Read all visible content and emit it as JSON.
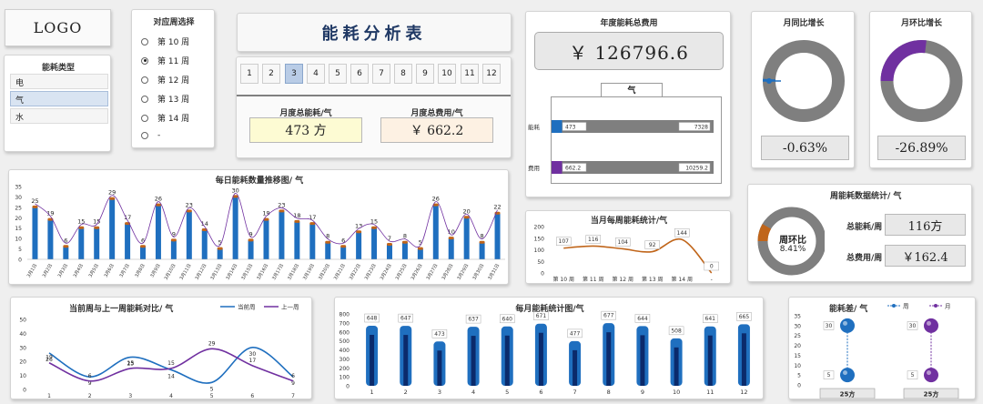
{
  "logo": "LOGO",
  "energy_type": {
    "title": "能耗类型",
    "items": [
      {
        "label": "电",
        "selected": false
      },
      {
        "label": "气",
        "selected": true
      },
      {
        "label": "水",
        "selected": false
      }
    ]
  },
  "week_select": {
    "title": "对应周选择",
    "weeks": [
      {
        "label": "第 10 周",
        "selected": false
      },
      {
        "label": "第 11 周",
        "selected": true
      },
      {
        "label": "第 12 周",
        "selected": false
      },
      {
        "label": "第 13 周",
        "selected": false
      },
      {
        "label": "第 14 周",
        "selected": false
      },
      {
        "label": "-",
        "selected": false
      }
    ]
  },
  "main_title": "能耗分析表",
  "months": {
    "labels": [
      "1",
      "2",
      "3",
      "4",
      "5",
      "6",
      "7",
      "8",
      "9",
      "10",
      "11",
      "12"
    ],
    "selected_index": 2
  },
  "monthly_kpi": {
    "energy_label": "月度总能耗/气",
    "energy_value": "473 方",
    "cost_label": "月度总费用/气",
    "cost_value": "￥ 662.2"
  },
  "annual": {
    "title": "年度能耗总费用",
    "value": "￥ 126796.6",
    "type_label": "气"
  },
  "yoy": {
    "title": "月同比增长",
    "value": "-0.63%",
    "fraction": 0.0063,
    "color": "#1f6fbf"
  },
  "mom": {
    "title": "月环比增长",
    "value": "-26.89%",
    "fraction": 0.2689,
    "color": "#7030a0"
  },
  "weekly_stats": {
    "title": "周能耗数据统计/ 气",
    "ring_label": "周环比",
    "ring_value": "8.41%",
    "ring_fraction": 0.0841,
    "energy_label": "总能耗/周",
    "energy_value": "116方",
    "cost_label": "总费用/周",
    "cost_value": "￥162.4"
  },
  "colors": {
    "blue": "#1f6fbf",
    "dark_blue": "#0b2a6b",
    "orange": "#c0651a",
    "purple": "#7030a0",
    "gray": "#7f7f7f",
    "navy_title": "#1f3864"
  },
  "chart_data": [
    {
      "id": "annual_bars",
      "type": "bar",
      "orientation": "horizontal",
      "categories": [
        "能耗",
        "费用"
      ],
      "values": [
        473,
        662.2
      ],
      "totals": [
        7328,
        10259.2
      ],
      "value_labels": [
        "473",
        "662.2"
      ],
      "total_labels": [
        "7328",
        "10259.2"
      ]
    },
    {
      "id": "daily",
      "type": "bar",
      "title": "每日能耗数量推移图/ 气",
      "categories": [
        "3月1日",
        "3月2日",
        "3月3日",
        "3月4日",
        "3月5日",
        "3月6日",
        "3月7日",
        "3月8日",
        "3月9日",
        "3月10日",
        "3月11日",
        "3月12日",
        "3月13日",
        "3月14日",
        "3月15日",
        "3月16日",
        "3月17日",
        "3月18日",
        "3月19日",
        "3月20日",
        "3月21日",
        "3月22日",
        "3月23日",
        "3月24日",
        "3月25日",
        "3月26日",
        "3月27日",
        "3月28日",
        "3月29日",
        "3月30日",
        "3月31日"
      ],
      "values": [
        25,
        19,
        6,
        15,
        15,
        29,
        17,
        6,
        26,
        9,
        23,
        14,
        5,
        30,
        9,
        19,
        23,
        18,
        17,
        8,
        6,
        13,
        15,
        7,
        8,
        5,
        26,
        10,
        20,
        8,
        22
      ],
      "ylim": [
        0,
        35
      ],
      "yticks": [
        0,
        5,
        10,
        15,
        20,
        25,
        30,
        35
      ],
      "grid": false,
      "overlay_line": true
    },
    {
      "id": "weekly",
      "type": "line",
      "title": "当月每周能耗统计/气",
      "categories": [
        "第 10 周",
        "第 11 周",
        "第 12 周",
        "第 13 周",
        "第 14 周",
        "-"
      ],
      "values": [
        107,
        116,
        104,
        92,
        144,
        0
      ],
      "ylim": [
        0,
        200
      ],
      "yticks": [
        0,
        50,
        100,
        150,
        200
      ]
    },
    {
      "id": "compare",
      "type": "line",
      "title": "当前周与上一周能耗对比/ 气",
      "categories": [
        "1",
        "2",
        "3",
        "4",
        "5",
        "6",
        "7"
      ],
      "series": [
        {
          "name": "当前周",
          "values": [
            26,
            9,
            23,
            14,
            5,
            30,
            9
          ],
          "color": "#1f6fbf"
        },
        {
          "name": "上一周",
          "values": [
            19,
            6,
            15,
            15,
            29,
            17,
            6
          ],
          "color": "#7030a0"
        }
      ],
      "ylim": [
        0,
        50
      ],
      "yticks": [
        0,
        10,
        20,
        30,
        40,
        50
      ],
      "legend": "top-right"
    },
    {
      "id": "monthly",
      "type": "bar",
      "title": "每月能耗统计图/气",
      "categories": [
        "1",
        "2",
        "3",
        "4",
        "5",
        "6",
        "7",
        "8",
        "9",
        "10",
        "11",
        "12"
      ],
      "values": [
        648,
        647,
        473,
        637,
        640,
        671,
        477,
        677,
        644,
        508,
        641,
        665
      ],
      "ylim": [
        0,
        800
      ],
      "yticks": [
        0,
        100,
        200,
        300,
        400,
        500,
        600,
        700,
        800
      ]
    },
    {
      "id": "diff",
      "type": "scatter",
      "title": "能耗差/ 气",
      "series": [
        {
          "name": "周",
          "values": [
            30,
            5
          ],
          "color": "#1f6fbf",
          "footer": "25方"
        },
        {
          "name": "月",
          "values": [
            30,
            5
          ],
          "color": "#7030a0",
          "footer": "25方"
        }
      ],
      "ylim": [
        0,
        35
      ],
      "yticks": [
        0,
        5,
        10,
        15,
        20,
        25,
        30,
        35
      ],
      "legend": "top"
    }
  ]
}
